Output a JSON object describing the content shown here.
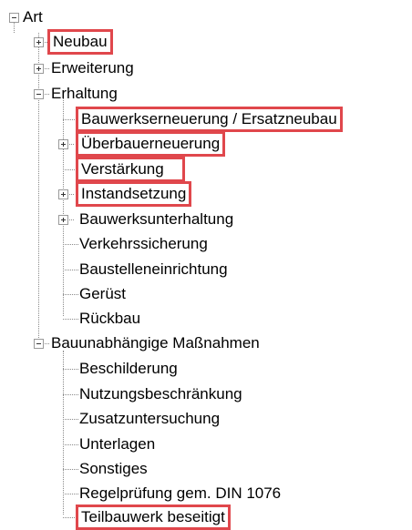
{
  "tree": {
    "root": {
      "label": "Art",
      "state": "expanded"
    },
    "level1": [
      {
        "label": "Neubau",
        "state": "collapsed",
        "highlighted": true
      },
      {
        "label": "Erweiterung",
        "state": "collapsed",
        "highlighted": false
      },
      {
        "label": "Erhaltung",
        "state": "expanded",
        "highlighted": false
      },
      {
        "label": "Bauunabhängige Maßnahmen",
        "state": "expanded",
        "highlighted": false
      }
    ],
    "erhaltung_children": [
      {
        "label": "Bauwerkserneuerung / Ersatzneubau",
        "state": "leaf",
        "highlighted": true
      },
      {
        "label": "Überbauerneuerung",
        "state": "collapsed",
        "highlighted": true
      },
      {
        "label": "Verstärkung",
        "state": "leaf",
        "highlighted": true
      },
      {
        "label": "Instandsetzung",
        "state": "collapsed",
        "highlighted": true
      },
      {
        "label": "Bauwerksunterhaltung",
        "state": "collapsed",
        "highlighted": false
      },
      {
        "label": "Verkehrssicherung",
        "state": "leaf",
        "highlighted": false
      },
      {
        "label": "Baustelleneinrichtung",
        "state": "leaf",
        "highlighted": false
      },
      {
        "label": "Gerüst",
        "state": "leaf",
        "highlighted": false
      },
      {
        "label": "Rückbau",
        "state": "leaf",
        "highlighted": false
      }
    ],
    "bauunabhaengig_children": [
      {
        "label": "Beschilderung",
        "state": "leaf",
        "highlighted": false
      },
      {
        "label": "Nutzungsbeschränkung",
        "state": "leaf",
        "highlighted": false
      },
      {
        "label": "Zusatzuntersuchung",
        "state": "leaf",
        "highlighted": false
      },
      {
        "label": "Unterlagen",
        "state": "leaf",
        "highlighted": false
      },
      {
        "label": "Sonstiges",
        "state": "leaf",
        "highlighted": false
      },
      {
        "label": "Regelprüfung gem. DIN 1076",
        "state": "leaf",
        "highlighted": false
      },
      {
        "label": "Teilbauwerk beseitigt",
        "state": "leaf",
        "highlighted": true
      }
    ]
  },
  "colors": {
    "highlight": "#e0474c",
    "connector": "#8a8a8a",
    "text": "#000000"
  },
  "icons": {
    "expanded": "minus-box-icon",
    "collapsed": "plus-box-icon"
  }
}
